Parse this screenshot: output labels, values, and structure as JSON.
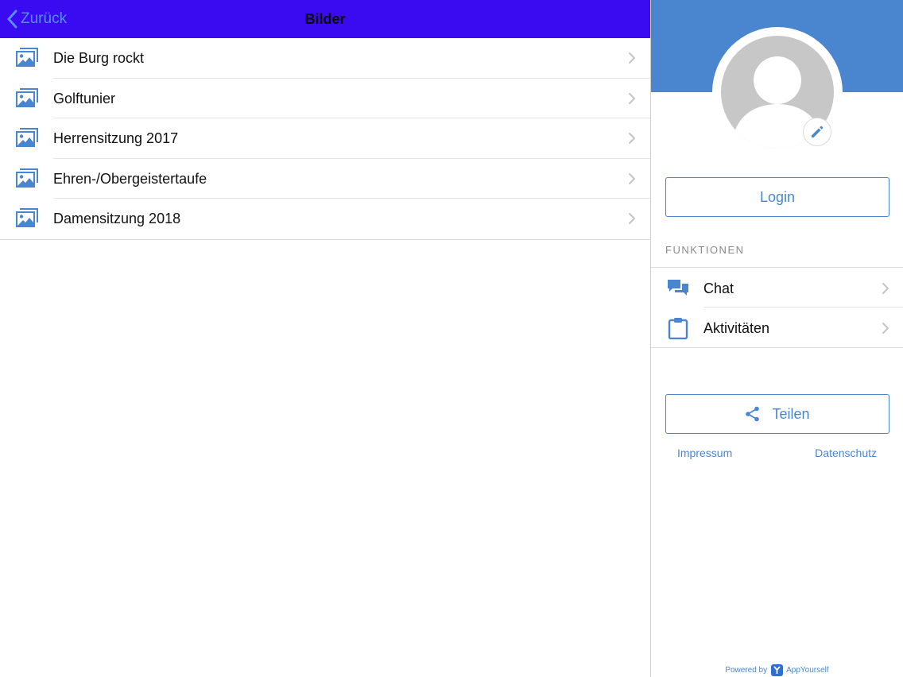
{
  "navbar": {
    "back_label": "Zurück",
    "title": "Bilder",
    "background": "#3a0af0"
  },
  "albums": [
    {
      "label": "Die Burg rockt",
      "icon": "images-icon"
    },
    {
      "label": "Golftunier",
      "icon": "images-icon"
    },
    {
      "label": "Herrensitzung 2017",
      "icon": "images-icon"
    },
    {
      "label": "Ehren-/Obergeistertaufe",
      "icon": "images-icon"
    },
    {
      "label": "Damensitzung 2018",
      "icon": "images-icon"
    }
  ],
  "sidebar": {
    "accent_color": "#4a86d0",
    "login_label": "Login",
    "section_title": "FUNKTIONEN",
    "items": [
      {
        "label": "Chat",
        "icon": "chat-icon"
      },
      {
        "label": "Aktivitäten",
        "icon": "clipboard-icon"
      }
    ],
    "share_label": "Teilen",
    "impressum_label": "Impressum",
    "datenschutz_label": "Datenschutz",
    "powered_by": "Powered by",
    "brand_name": "AppYourself"
  }
}
